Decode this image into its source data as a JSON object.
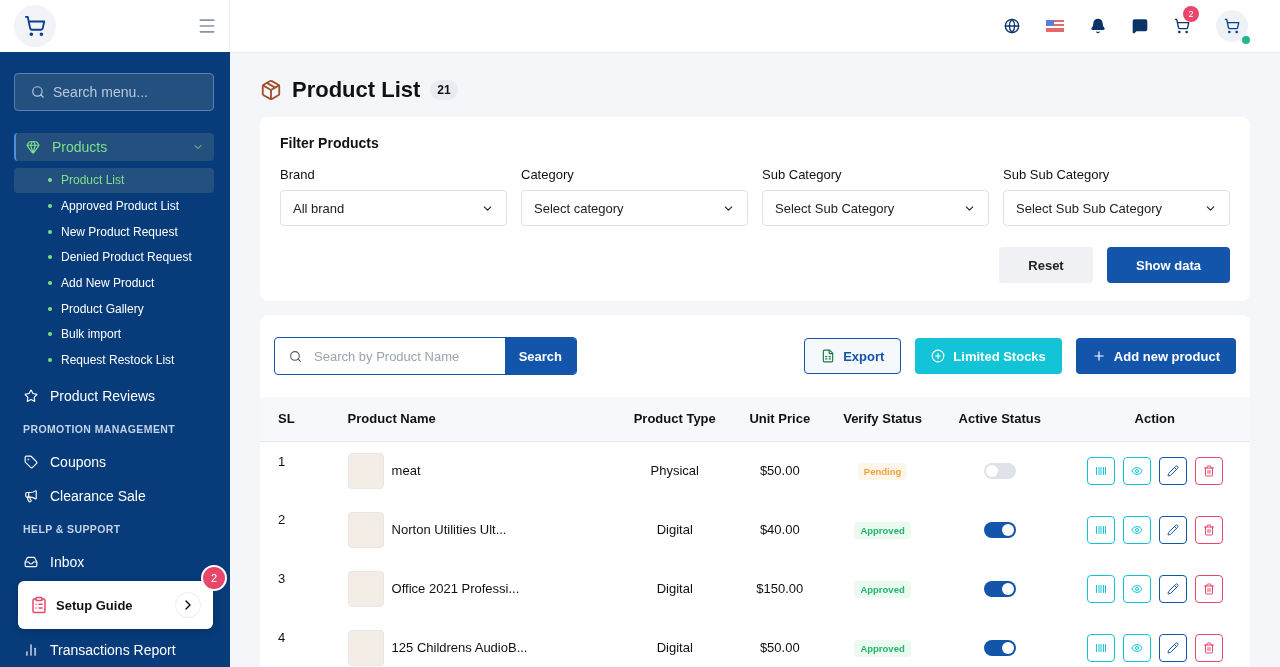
{
  "header": {
    "cart_badge": "2"
  },
  "sidebar": {
    "search": {
      "placeholder": "Search menu..."
    },
    "menu": [
      {
        "kind": "group",
        "label": "Products",
        "expanded": true,
        "selected": true,
        "children": [
          {
            "label": "Product List",
            "selected": true
          },
          {
            "label": "Approved Product List",
            "selected": false
          },
          {
            "label": "New Product Request",
            "selected": false
          },
          {
            "label": "Denied Product Request",
            "selected": false
          },
          {
            "label": "Add New Product",
            "selected": false
          },
          {
            "label": "Product Gallery",
            "selected": false
          },
          {
            "label": "Bulk import",
            "selected": false
          },
          {
            "label": "Request Restock List",
            "selected": false
          }
        ]
      },
      {
        "kind": "link",
        "label": "Product Reviews"
      },
      {
        "kind": "heading",
        "label": "PROMOTION MANAGEMENT"
      },
      {
        "kind": "link",
        "label": "Coupons"
      },
      {
        "kind": "link",
        "label": "Clearance Sale"
      },
      {
        "kind": "heading",
        "label": "HELP & SUPPORT"
      },
      {
        "kind": "link",
        "label": "Inbox"
      },
      {
        "kind": "link",
        "label": "Transactions Report"
      }
    ],
    "setup_guide": {
      "title": "Setup Guide",
      "badge": "2"
    }
  },
  "page": {
    "title": "Product List",
    "count": "21"
  },
  "filter": {
    "title": "Filter Products",
    "fields": [
      {
        "label": "Brand",
        "value": "All brand"
      },
      {
        "label": "Category",
        "value": "Select category"
      },
      {
        "label": "Sub Category",
        "value": "Select Sub Category"
      },
      {
        "label": "Sub Sub Category",
        "value": "Select Sub Sub Category"
      }
    ],
    "buttons": [
      {
        "kind": "secondary",
        "label": "Reset"
      },
      {
        "kind": "primary",
        "label": "Show data"
      }
    ]
  },
  "toolbar": {
    "search": {
      "placeholder": "Search by Product Name",
      "button": "Search"
    },
    "buttons": [
      {
        "kind": "export",
        "label": "Export"
      },
      {
        "kind": "stock",
        "label": "Limited Stocks"
      },
      {
        "kind": "add",
        "label": "Add new product"
      }
    ]
  },
  "table": {
    "columns": [
      "SL",
      "Product Name",
      "Product Type",
      "Unit Price",
      "Verify Status",
      "Active Status",
      "Action"
    ],
    "rows": [
      {
        "sl": "1",
        "name": "meat",
        "type": "Physical",
        "price": "$50.00",
        "verify": {
          "label": "Pending",
          "kind": "pending"
        },
        "active": false
      },
      {
        "sl": "2",
        "name": "Norton Utilities Ult...",
        "type": "Digital",
        "price": "$40.00",
        "verify": {
          "label": "Approved",
          "kind": "approved"
        },
        "active": true
      },
      {
        "sl": "3",
        "name": "Office 2021 Professi...",
        "type": "Digital",
        "price": "$150.00",
        "verify": {
          "label": "Approved",
          "kind": "approved"
        },
        "active": true
      },
      {
        "sl": "4",
        "name": "125 Childrens AudioB...",
        "type": "Digital",
        "price": "$50.00",
        "verify": {
          "label": "Approved",
          "kind": "approved"
        },
        "active": true
      }
    ]
  }
}
